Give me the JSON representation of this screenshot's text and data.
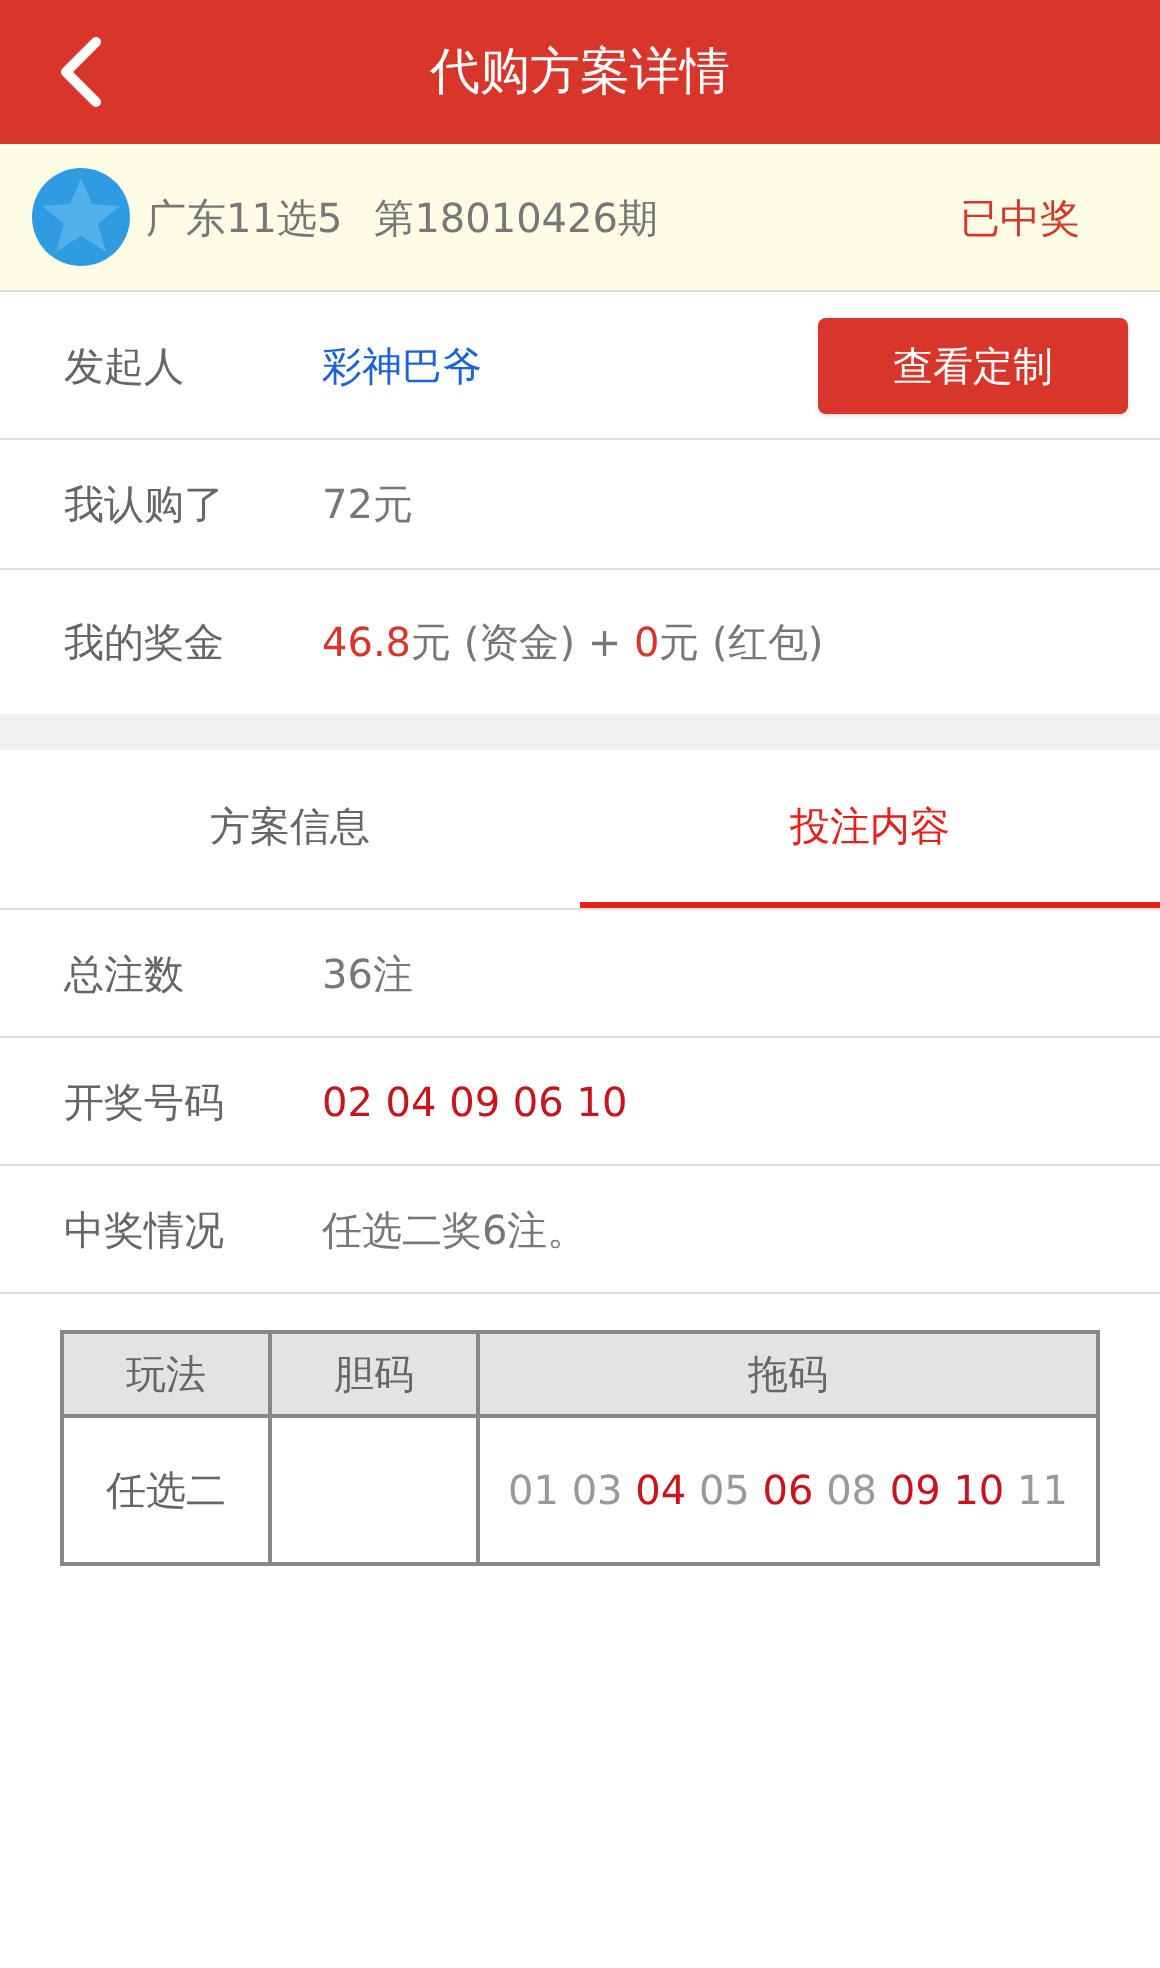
{
  "header": {
    "title": "代购方案详情"
  },
  "lottery": {
    "name": "广东11选5",
    "issue": "第18010426期",
    "status": "已中奖"
  },
  "initiator": {
    "label": "发起人",
    "value": "彩神巴爷",
    "button": "查看定制"
  },
  "subscribed": {
    "label": "我认购了",
    "value": "72元"
  },
  "prize": {
    "label": "我的奖金",
    "segments": [
      {
        "text": "46.8",
        "highlight": true
      },
      {
        "text": "元 (资金) + ",
        "highlight": false
      },
      {
        "text": "0",
        "highlight": true
      },
      {
        "text": "元 (红包)",
        "highlight": false
      }
    ]
  },
  "tabs": [
    {
      "label": "方案信息",
      "selected": false
    },
    {
      "label": "投注内容",
      "selected": true
    }
  ],
  "details": [
    {
      "label": "总注数",
      "value": "36注",
      "highlight": false
    },
    {
      "label": "开奖号码",
      "value": "02 04 09 06 10",
      "highlight": true
    },
    {
      "label": "中奖情况",
      "value": "任选二奖6注。",
      "highlight": false
    }
  ],
  "table": {
    "columns": [
      "玩法",
      "胆码",
      "拖码"
    ],
    "rows": [
      {
        "play": "任选二",
        "numbers": [
          {
            "text": "01",
            "hit": false
          },
          {
            "text": "03",
            "hit": false
          },
          {
            "text": "04",
            "hit": true
          },
          {
            "text": "05",
            "hit": false
          },
          {
            "text": "06",
            "hit": true
          },
          {
            "text": "08",
            "hit": false
          },
          {
            "text": "09",
            "hit": true
          },
          {
            "text": "10",
            "hit": true
          },
          {
            "text": "11",
            "hit": false
          }
        ]
      }
    ]
  }
}
